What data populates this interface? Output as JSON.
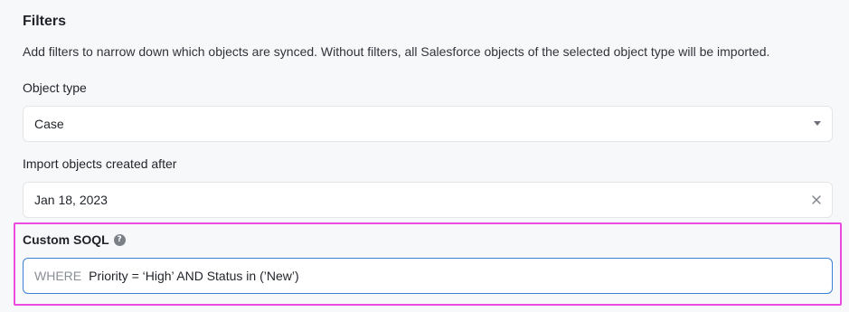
{
  "filters": {
    "title": "Filters",
    "description": "Add filters to narrow down which objects are synced. Without filters, all Salesforce objects of the selected object type will be imported."
  },
  "object_type": {
    "label": "Object type",
    "value": "Case"
  },
  "created_after": {
    "label": "Import objects created after",
    "value": "Jan 18, 2023"
  },
  "custom_soql": {
    "label": "Custom SOQL",
    "help_icon": "?",
    "prefix": "WHERE",
    "value": "Priority = ‘High’ AND Status in (’New’)"
  },
  "colors": {
    "highlight": "#ec4be0",
    "focus_border": "#3b82d6"
  },
  "icons": [
    "help-icon",
    "caret-down-icon",
    "clear-icon"
  ]
}
